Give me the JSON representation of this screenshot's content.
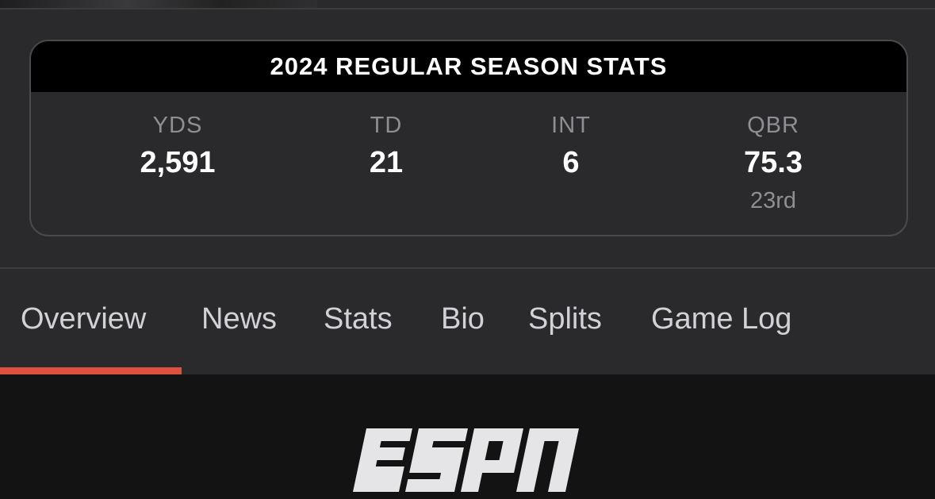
{
  "stats_card": {
    "title": "2024 REGULAR SEASON STATS",
    "stats": [
      {
        "label": "YDS",
        "value": "2,591",
        "rank": ""
      },
      {
        "label": "TD",
        "value": "21",
        "rank": ""
      },
      {
        "label": "INT",
        "value": "6",
        "rank": ""
      },
      {
        "label": "QBR",
        "value": "75.3",
        "rank": "23rd"
      }
    ]
  },
  "tabs": [
    {
      "label": "Overview",
      "active": true
    },
    {
      "label": "News",
      "active": false
    },
    {
      "label": "Stats",
      "active": false
    },
    {
      "label": "Bio",
      "active": false
    },
    {
      "label": "Splits",
      "active": false
    },
    {
      "label": "Game Log",
      "active": false
    }
  ],
  "colors": {
    "background": "#2a2a2c",
    "header": "#000000",
    "accent": "#e0503e",
    "muted_text": "#8e8e93",
    "footer": "#131314"
  },
  "footer": {
    "logo": "ESPN"
  }
}
